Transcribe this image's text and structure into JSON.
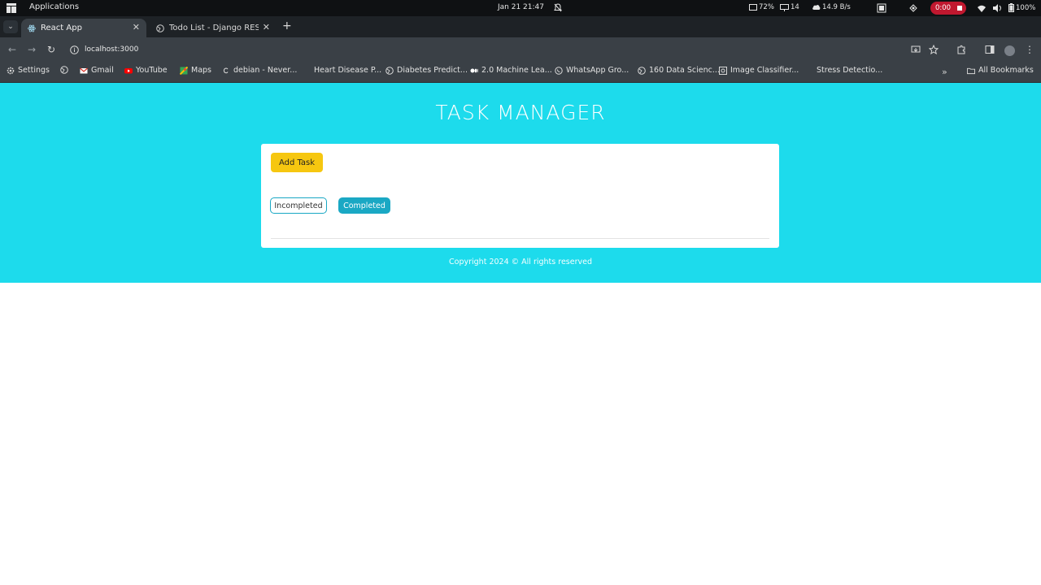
{
  "system_bar": {
    "apps_label": "Applications",
    "clock": "Jan 21  21:47",
    "cpu": "72%",
    "displays": "14",
    "network": "14.9 B/s",
    "record_time": "0:00",
    "battery": "100%"
  },
  "tabs": [
    {
      "label": "React App",
      "active": true
    },
    {
      "label": "Todo List - Django RES",
      "active": false
    }
  ],
  "toolbar": {
    "url": "localhost:3000"
  },
  "bookmarks": {
    "items": [
      {
        "label": "Settings"
      },
      {
        "label": ""
      },
      {
        "label": "Gmail"
      },
      {
        "label": "YouTube"
      },
      {
        "label": "Maps"
      },
      {
        "label": "debian - Never..."
      },
      {
        "label": "Heart Disease P..."
      },
      {
        "label": "Diabetes Predict..."
      },
      {
        "label": "2.0 Machine Lea..."
      },
      {
        "label": "WhatsApp Gro..."
      },
      {
        "label": "160 Data Scienc..."
      },
      {
        "label": "Image Classifier..."
      },
      {
        "label": "Stress Detectio..."
      }
    ],
    "all_bookmarks": "All Bookmarks"
  },
  "app": {
    "title": "TASK MANAGER",
    "add_task_label": "Add Task",
    "filter_incomplete_label": "Incompleted",
    "filter_completed_label": "Completed",
    "footer": "Copyright 2024 © All rights reserved"
  },
  "colors": {
    "page_bg": "#1ddbec",
    "add_task": "#f6c710",
    "accent": "#1aa8c4"
  }
}
